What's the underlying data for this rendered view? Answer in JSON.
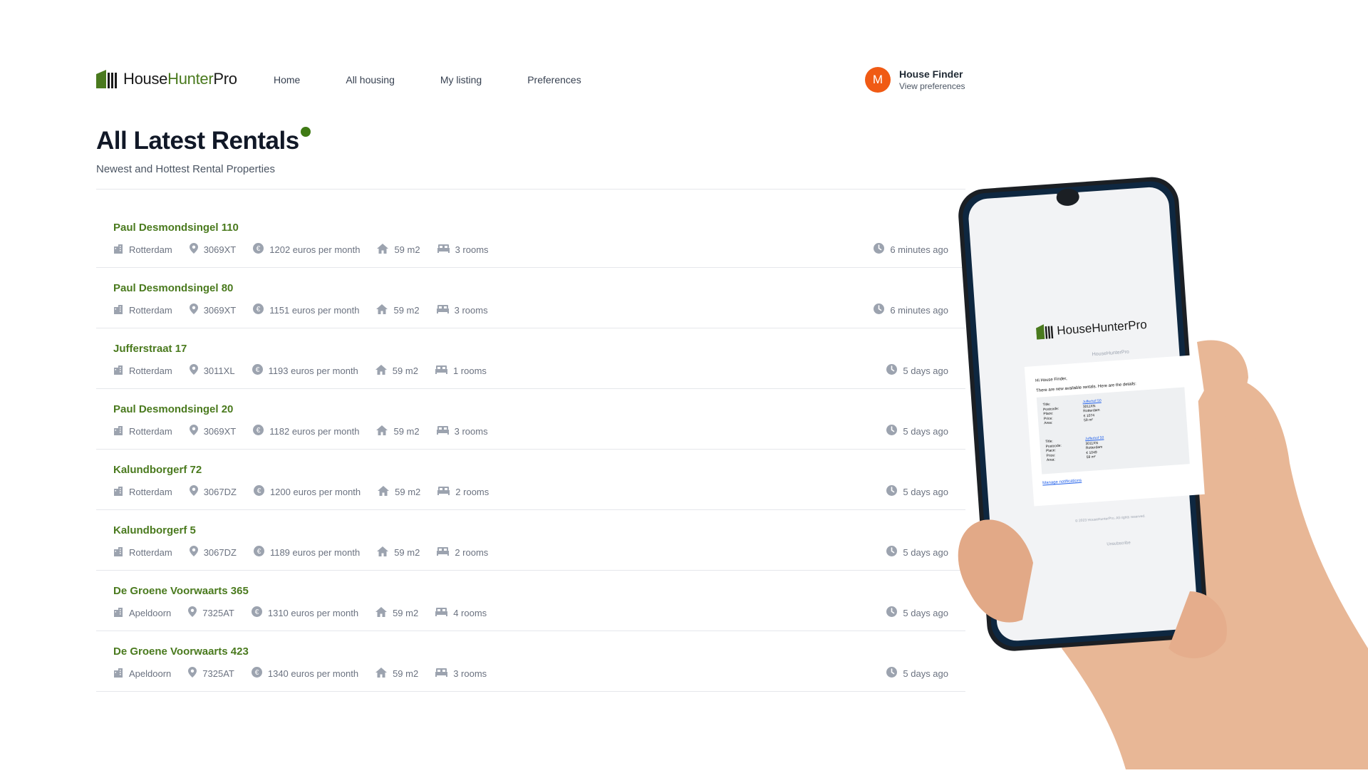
{
  "brand": {
    "name_part1": "House",
    "name_part2": "Hunter",
    "name_part3": "Pro",
    "accent": "#4a7a1e"
  },
  "nav": [
    {
      "label": "Home"
    },
    {
      "label": "All housing"
    },
    {
      "label": "My listing"
    },
    {
      "label": "Preferences"
    }
  ],
  "user": {
    "initial": "M",
    "name": "House Finder",
    "link": "View preferences",
    "avatar_color": "#f05a14"
  },
  "page": {
    "title": "All Latest Rentals",
    "subtitle": "Newest and Hottest Rental Properties"
  },
  "listings": [
    {
      "title": "Paul Desmondsingel 110",
      "city": "Rotterdam",
      "postcode": "3069XT",
      "price": "1202 euros per month",
      "area": "59 m2",
      "rooms": "3 rooms",
      "time": "6 minutes ago"
    },
    {
      "title": "Paul Desmondsingel 80",
      "city": "Rotterdam",
      "postcode": "3069XT",
      "price": "1151 euros per month",
      "area": "59 m2",
      "rooms": "3 rooms",
      "time": "6 minutes ago"
    },
    {
      "title": "Jufferstraat 17",
      "city": "Rotterdam",
      "postcode": "3011XL",
      "price": "1193 euros per month",
      "area": "59 m2",
      "rooms": "1 rooms",
      "time": "5 days ago"
    },
    {
      "title": "Paul Desmondsingel 20",
      "city": "Rotterdam",
      "postcode": "3069XT",
      "price": "1182 euros per month",
      "area": "59 m2",
      "rooms": "3 rooms",
      "time": "5 days ago"
    },
    {
      "title": "Kalundborgerf 72",
      "city": "Rotterdam",
      "postcode": "3067DZ",
      "price": "1200 euros per month",
      "area": "59 m2",
      "rooms": "2 rooms",
      "time": "5 days ago"
    },
    {
      "title": "Kalundborgerf 5",
      "city": "Rotterdam",
      "postcode": "3067DZ",
      "price": "1189 euros per month",
      "area": "59 m2",
      "rooms": "2 rooms",
      "time": "5 days ago"
    },
    {
      "title": "De Groene Voorwaarts 365",
      "city": "Apeldoorn",
      "postcode": "7325AT",
      "price": "1310 euros per month",
      "area": "59 m2",
      "rooms": "4 rooms",
      "time": "5 days ago"
    },
    {
      "title": "De Groene Voorwaarts 423",
      "city": "Apeldoorn",
      "postcode": "7325AT",
      "price": "1340 euros per month",
      "area": "59 m2",
      "rooms": "3 rooms",
      "time": "5 days ago"
    }
  ],
  "email": {
    "brand": "HouseHunterPro",
    "sender": "HouseHunterPro",
    "greeting": "Hi House Finder,",
    "intro": "There are new available rentals. Here are the details:",
    "labels": {
      "title": "Title:",
      "postcode": "Postcode:",
      "place": "Place:",
      "price": "Price:",
      "area": "Area:"
    },
    "entries": [
      {
        "title": "Jufferhof 50",
        "postcode": "3011XN",
        "place": "Rotterdam",
        "price": "€ 1074",
        "area": "59 m²"
      },
      {
        "title": "Jufferhof 50",
        "postcode": "3011XN",
        "place": "Rotterdam",
        "price": "€ 1049",
        "area": "59 m²"
      }
    ],
    "manage": "Manage notifications",
    "footer": "© 2023 HouseHunterPro. All rights reserved.",
    "unsubscribe": "Unsubscribe"
  }
}
